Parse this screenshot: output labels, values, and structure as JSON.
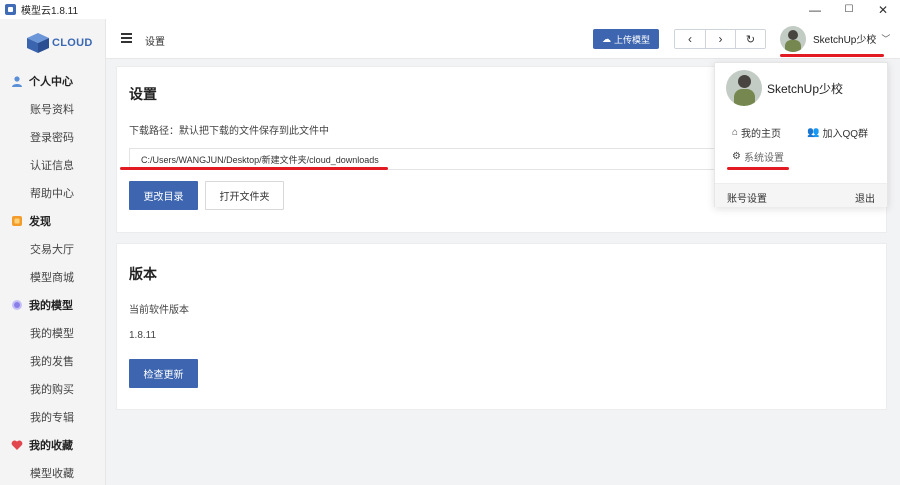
{
  "window": {
    "title": "模型云1.8.11",
    "controls": {
      "minimize": "—",
      "maximize": "☐",
      "close": "✕"
    }
  },
  "sidebar": {
    "logo_text": "CLOUD",
    "sections": [
      {
        "label": "个人中心",
        "icon": "user-icon",
        "color": "#5b8fd6",
        "items": [
          "账号资料",
          "登录密码",
          "认证信息",
          "帮助中心"
        ]
      },
      {
        "label": "发现",
        "icon": "discover-icon",
        "color": "#f39c2c",
        "items": [
          "交易大厅",
          "模型商城"
        ]
      },
      {
        "label": "我的模型",
        "icon": "model-icon",
        "color": "#8a7fe8",
        "items": [
          "我的模型",
          "我的发售",
          "我的购买",
          "我的专辑"
        ]
      },
      {
        "label": "我的收藏",
        "icon": "heart-icon",
        "color": "#e2474e",
        "items": [
          "模型收藏"
        ]
      }
    ]
  },
  "header": {
    "breadcrumb": "设置",
    "upload_label": "上传模型",
    "nav": {
      "back": "‹",
      "forward": "›",
      "refresh": "↻"
    },
    "user_name": "SketchUp少校",
    "chevron": "﹀"
  },
  "settings_card": {
    "title": "设置",
    "download_label": "下载路径：默认把下载的文件保存到此文件中",
    "download_path": "C:/Users/WANGJUN/Desktop/新建文件夹/cloud_downloads",
    "change_dir_label": "更改目录",
    "open_folder_label": "打开文件夹"
  },
  "version_card": {
    "title": "版本",
    "current_label": "当前软件版本",
    "version": "1.8.11",
    "check_update_label": "检查更新"
  },
  "dropdown": {
    "user_name": "SketchUp少校",
    "home_label": "我的主页",
    "qq_label": "加入QQ群",
    "settings_label": "系统设置",
    "account_settings_label": "账号设置",
    "logout_label": "退出"
  },
  "colors": {
    "accent": "#3e66b0",
    "annotation_red": "#e21b23"
  }
}
